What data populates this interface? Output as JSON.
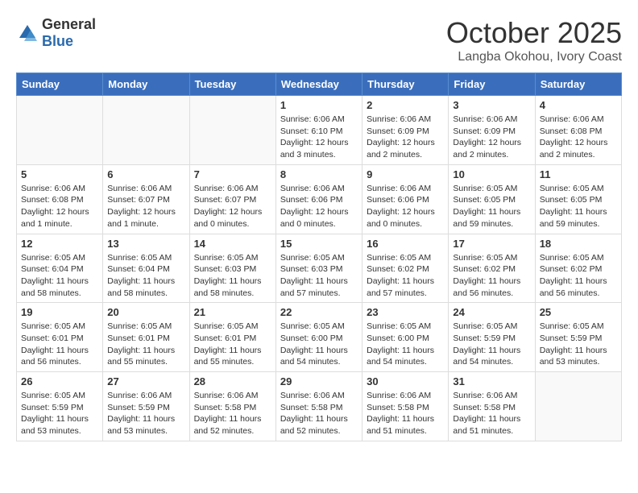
{
  "header": {
    "logo_general": "General",
    "logo_blue": "Blue",
    "month_title": "October 2025",
    "location": "Langba Okohou, Ivory Coast"
  },
  "days_of_week": [
    "Sunday",
    "Monday",
    "Tuesday",
    "Wednesday",
    "Thursday",
    "Friday",
    "Saturday"
  ],
  "weeks": [
    [
      {
        "day": "",
        "info": ""
      },
      {
        "day": "",
        "info": ""
      },
      {
        "day": "",
        "info": ""
      },
      {
        "day": "1",
        "info": "Sunrise: 6:06 AM\nSunset: 6:10 PM\nDaylight: 12 hours\nand 3 minutes."
      },
      {
        "day": "2",
        "info": "Sunrise: 6:06 AM\nSunset: 6:09 PM\nDaylight: 12 hours\nand 2 minutes."
      },
      {
        "day": "3",
        "info": "Sunrise: 6:06 AM\nSunset: 6:09 PM\nDaylight: 12 hours\nand 2 minutes."
      },
      {
        "day": "4",
        "info": "Sunrise: 6:06 AM\nSunset: 6:08 PM\nDaylight: 12 hours\nand 2 minutes."
      }
    ],
    [
      {
        "day": "5",
        "info": "Sunrise: 6:06 AM\nSunset: 6:08 PM\nDaylight: 12 hours\nand 1 minute."
      },
      {
        "day": "6",
        "info": "Sunrise: 6:06 AM\nSunset: 6:07 PM\nDaylight: 12 hours\nand 1 minute."
      },
      {
        "day": "7",
        "info": "Sunrise: 6:06 AM\nSunset: 6:07 PM\nDaylight: 12 hours\nand 0 minutes."
      },
      {
        "day": "8",
        "info": "Sunrise: 6:06 AM\nSunset: 6:06 PM\nDaylight: 12 hours\nand 0 minutes."
      },
      {
        "day": "9",
        "info": "Sunrise: 6:06 AM\nSunset: 6:06 PM\nDaylight: 12 hours\nand 0 minutes."
      },
      {
        "day": "10",
        "info": "Sunrise: 6:05 AM\nSunset: 6:05 PM\nDaylight: 11 hours\nand 59 minutes."
      },
      {
        "day": "11",
        "info": "Sunrise: 6:05 AM\nSunset: 6:05 PM\nDaylight: 11 hours\nand 59 minutes."
      }
    ],
    [
      {
        "day": "12",
        "info": "Sunrise: 6:05 AM\nSunset: 6:04 PM\nDaylight: 11 hours\nand 58 minutes."
      },
      {
        "day": "13",
        "info": "Sunrise: 6:05 AM\nSunset: 6:04 PM\nDaylight: 11 hours\nand 58 minutes."
      },
      {
        "day": "14",
        "info": "Sunrise: 6:05 AM\nSunset: 6:03 PM\nDaylight: 11 hours\nand 58 minutes."
      },
      {
        "day": "15",
        "info": "Sunrise: 6:05 AM\nSunset: 6:03 PM\nDaylight: 11 hours\nand 57 minutes."
      },
      {
        "day": "16",
        "info": "Sunrise: 6:05 AM\nSunset: 6:02 PM\nDaylight: 11 hours\nand 57 minutes."
      },
      {
        "day": "17",
        "info": "Sunrise: 6:05 AM\nSunset: 6:02 PM\nDaylight: 11 hours\nand 56 minutes."
      },
      {
        "day": "18",
        "info": "Sunrise: 6:05 AM\nSunset: 6:02 PM\nDaylight: 11 hours\nand 56 minutes."
      }
    ],
    [
      {
        "day": "19",
        "info": "Sunrise: 6:05 AM\nSunset: 6:01 PM\nDaylight: 11 hours\nand 56 minutes."
      },
      {
        "day": "20",
        "info": "Sunrise: 6:05 AM\nSunset: 6:01 PM\nDaylight: 11 hours\nand 55 minutes."
      },
      {
        "day": "21",
        "info": "Sunrise: 6:05 AM\nSunset: 6:01 PM\nDaylight: 11 hours\nand 55 minutes."
      },
      {
        "day": "22",
        "info": "Sunrise: 6:05 AM\nSunset: 6:00 PM\nDaylight: 11 hours\nand 54 minutes."
      },
      {
        "day": "23",
        "info": "Sunrise: 6:05 AM\nSunset: 6:00 PM\nDaylight: 11 hours\nand 54 minutes."
      },
      {
        "day": "24",
        "info": "Sunrise: 6:05 AM\nSunset: 5:59 PM\nDaylight: 11 hours\nand 54 minutes."
      },
      {
        "day": "25",
        "info": "Sunrise: 6:05 AM\nSunset: 5:59 PM\nDaylight: 11 hours\nand 53 minutes."
      }
    ],
    [
      {
        "day": "26",
        "info": "Sunrise: 6:05 AM\nSunset: 5:59 PM\nDaylight: 11 hours\nand 53 minutes."
      },
      {
        "day": "27",
        "info": "Sunrise: 6:06 AM\nSunset: 5:59 PM\nDaylight: 11 hours\nand 53 minutes."
      },
      {
        "day": "28",
        "info": "Sunrise: 6:06 AM\nSunset: 5:58 PM\nDaylight: 11 hours\nand 52 minutes."
      },
      {
        "day": "29",
        "info": "Sunrise: 6:06 AM\nSunset: 5:58 PM\nDaylight: 11 hours\nand 52 minutes."
      },
      {
        "day": "30",
        "info": "Sunrise: 6:06 AM\nSunset: 5:58 PM\nDaylight: 11 hours\nand 51 minutes."
      },
      {
        "day": "31",
        "info": "Sunrise: 6:06 AM\nSunset: 5:58 PM\nDaylight: 11 hours\nand 51 minutes."
      },
      {
        "day": "",
        "info": ""
      }
    ]
  ]
}
